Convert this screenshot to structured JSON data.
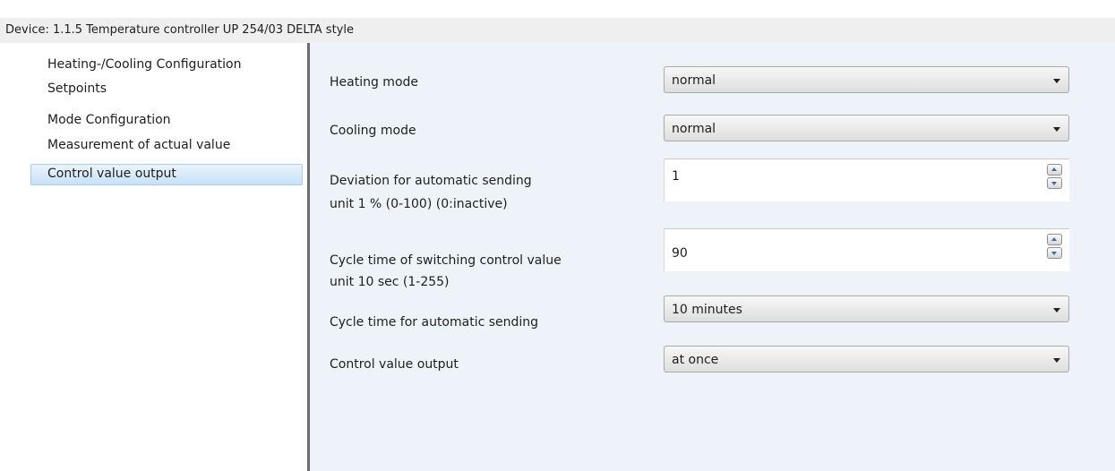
{
  "window": {
    "title": "Device: 1.1.5  Temperature controller UP 254/03 DELTA style"
  },
  "sidebar": {
    "items": [
      {
        "label": "Heating-/Cooling  Configuration",
        "selected": false
      },
      {
        "label": "Setpoints",
        "selected": false
      },
      {
        "label": "Mode  Configuration",
        "selected": false
      },
      {
        "label": "Measurement of actual value",
        "selected": false
      },
      {
        "label": "Control value output",
        "selected": true
      }
    ]
  },
  "params": {
    "heating_mode": {
      "label": "Heating mode",
      "value": "normal"
    },
    "cooling_mode": {
      "label": "Cooling mode",
      "value": "normal"
    },
    "deviation": {
      "label_line1": "Deviation for automatic sending",
      "label_line2": "unit 1 %  (0-100)  (0:inactive)",
      "value": "1"
    },
    "cycle_switching": {
      "label_line1": "Cycle time of switching control value",
      "label_line2": "unit 10 sec (1-255)",
      "value": "90"
    },
    "cycle_auto": {
      "label": "Cycle time for automatic sending",
      "value": "10 minutes"
    },
    "control_output": {
      "label": "Control value output",
      "value": "at once"
    }
  },
  "icons": {
    "dropdown": "chevron-down-icon",
    "spin_up": "arrow-up-icon",
    "spin_down": "arrow-down-icon"
  },
  "colors": {
    "content_bg": "#eef3f9",
    "selection": "#c7e1f7",
    "splitter": "#6b6b6b"
  }
}
